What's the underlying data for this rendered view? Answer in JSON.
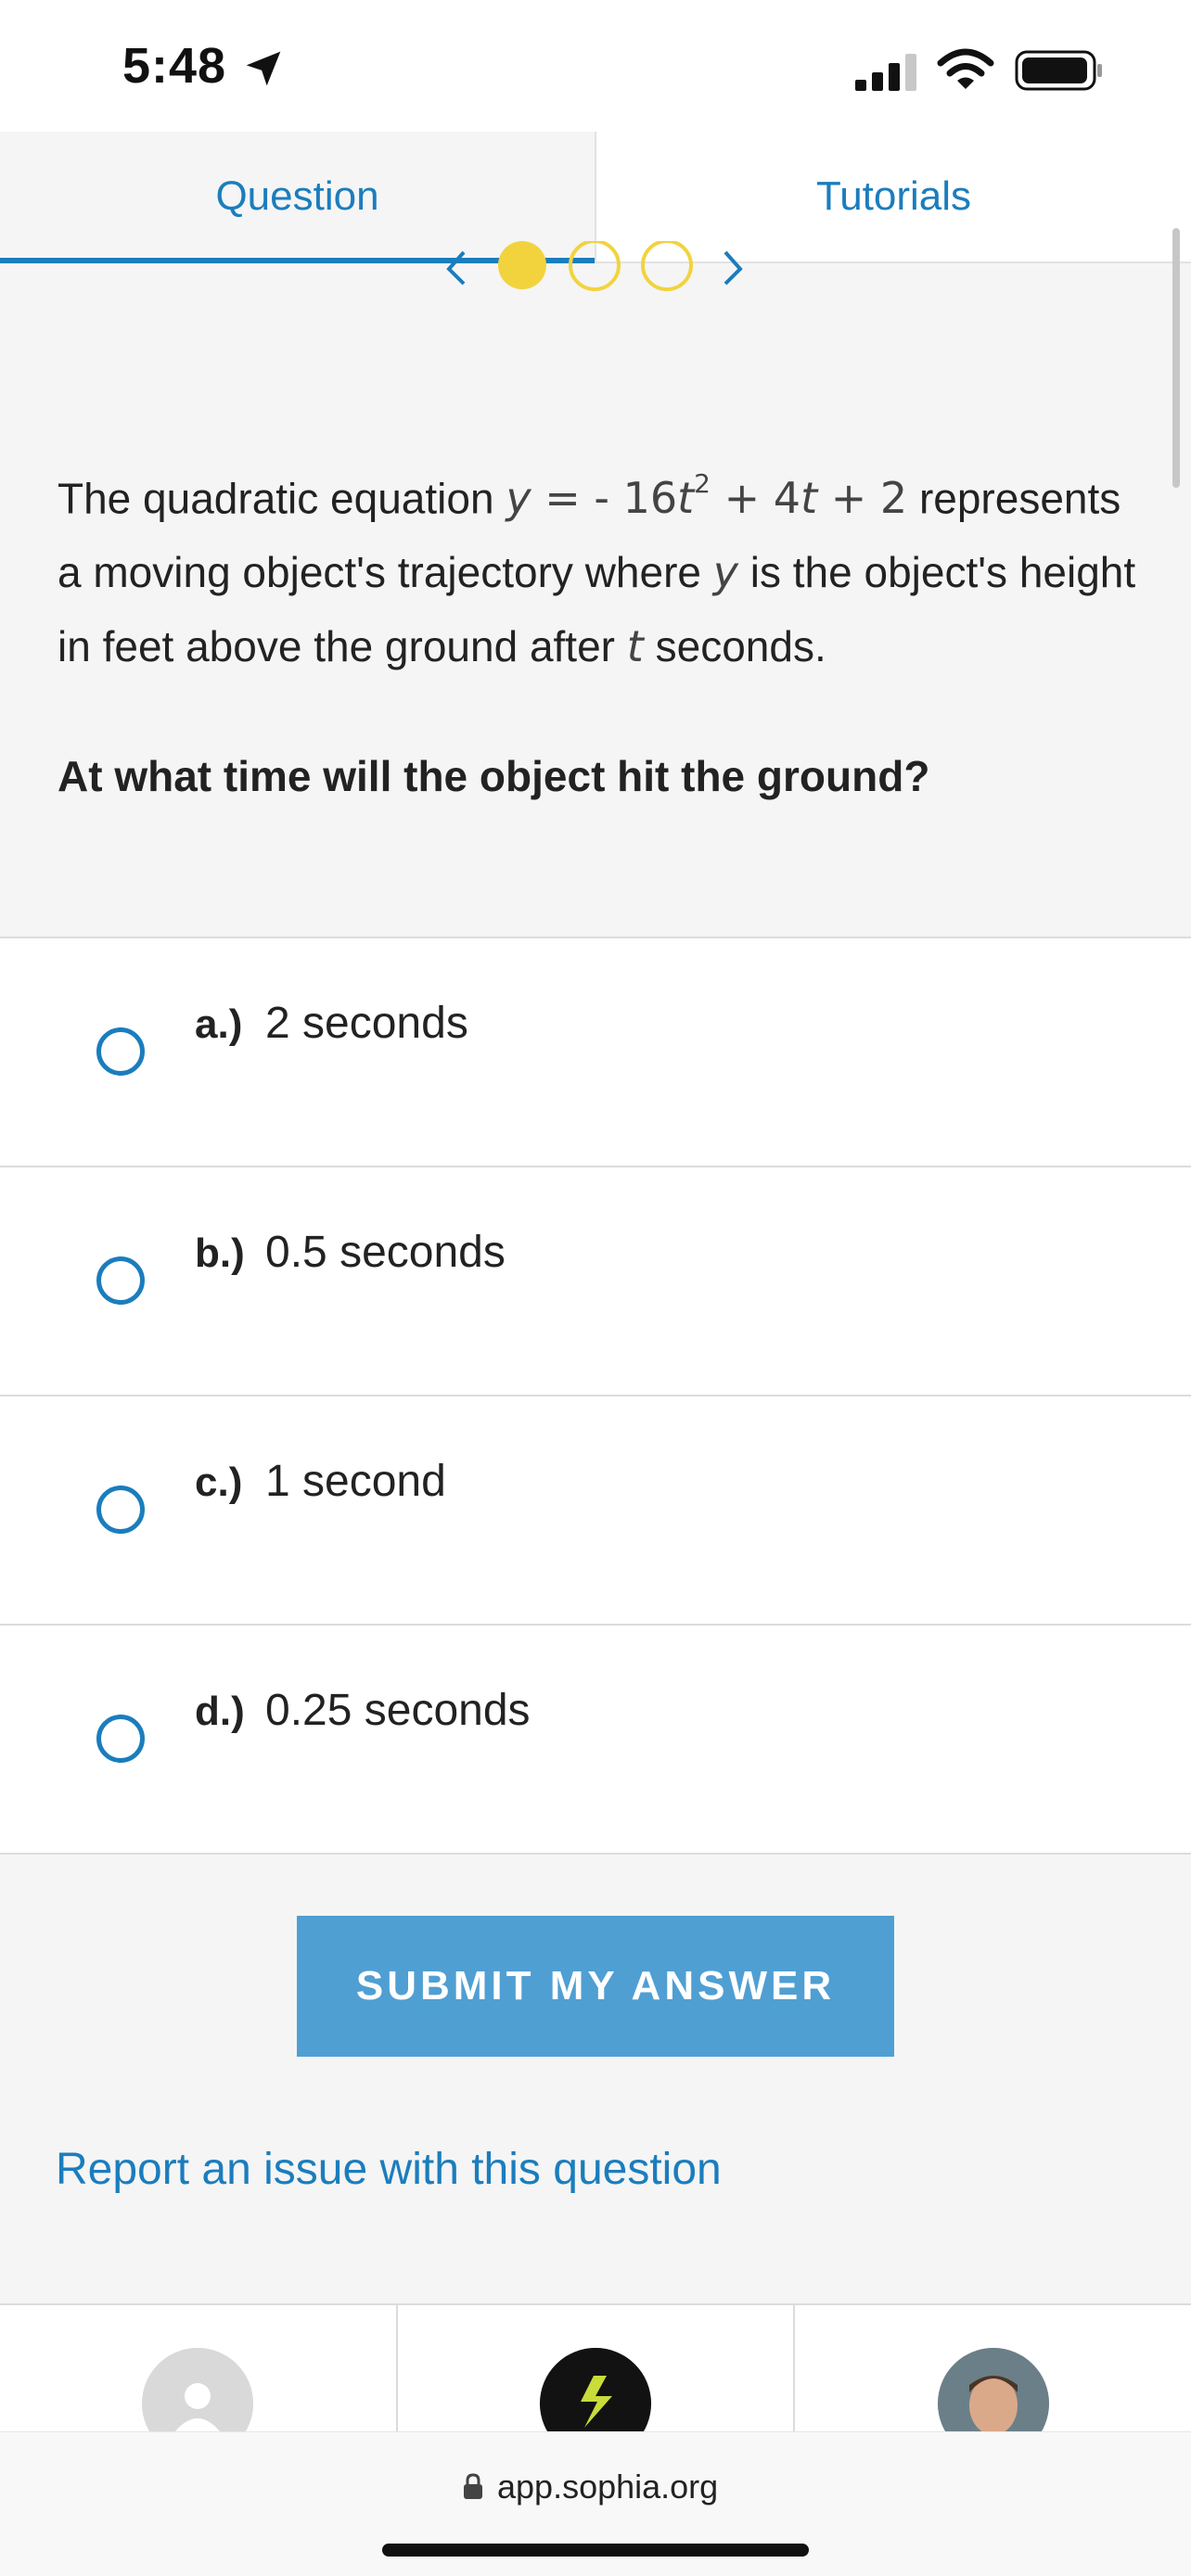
{
  "status_bar": {
    "time": "5:48",
    "icons": [
      "location-arrow-icon",
      "cellular-signal-icon",
      "wifi-icon",
      "battery-icon"
    ]
  },
  "tabs": [
    {
      "label": "Question",
      "active": true
    },
    {
      "label": "Tutorials",
      "active": false
    }
  ],
  "pager": {
    "icons": [
      "chevron-left-icon",
      "chevron-right-icon"
    ],
    "dots": [
      {
        "state": "filled"
      },
      {
        "state": "outline"
      },
      {
        "state": "outline"
      }
    ]
  },
  "question": {
    "intro": "The quadratic equation ",
    "eq_y": "y",
    "eq_eq": " = - 16",
    "eq_t1": "t",
    "eq_exp": "2",
    "eq_plus4": " + 4",
    "eq_t2": "t",
    "eq_plus2": " + 2",
    "text_a": " represents a moving object's trajectory where ",
    "var_y": "y",
    "text_b": " is the object's height in feet above the ground after ",
    "var_t": "t",
    "text_c": " seconds.",
    "prompt": "At what time will the object hit the ground?"
  },
  "options": [
    {
      "letter": "a.)",
      "text": "2 seconds"
    },
    {
      "letter": "b.)",
      "text": "0.5 seconds"
    },
    {
      "letter": "c.)",
      "text": "1 second"
    },
    {
      "letter": "d.)",
      "text": "0.25 seconds"
    }
  ],
  "submit": {
    "label": "SUBMIT MY ANSWER"
  },
  "report_link": "Report an issue with this question",
  "bottom_nav": {
    "items": [
      "profile-placeholder",
      "sophia-logo",
      "user-photo"
    ]
  },
  "browser": {
    "url": "app.sophia.org"
  },
  "colors": {
    "accent": "#1b7dbd",
    "button": "#4f9fd3",
    "pager_dot": "#f2d33e",
    "background": "#f5f5f5"
  }
}
